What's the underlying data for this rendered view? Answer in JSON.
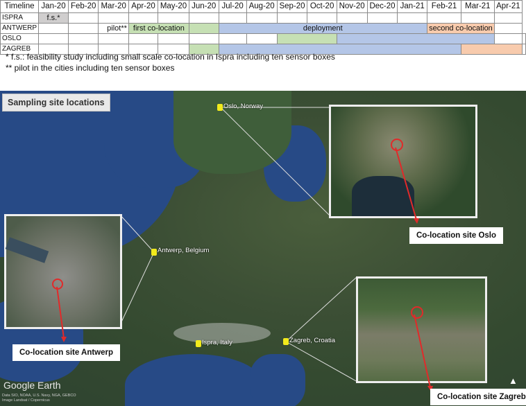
{
  "timeline": {
    "header_label": "Timeline",
    "months": [
      "Jan-20",
      "Feb-20",
      "Mar-20",
      "Apr-20",
      "May-20",
      "Jun-20",
      "Jul-20",
      "Aug-20",
      "Sep-20",
      "Oct-20",
      "Nov-20",
      "Dec-20",
      "Jan-21",
      "Feb-21",
      "Mar-21",
      "Apr-21"
    ],
    "rows": [
      {
        "label": "ISPRA",
        "bar_text": "f.s.*"
      },
      {
        "label": "ANTWERP",
        "pilot_text": "pilot**",
        "first_text": "first co-location",
        "deploy_text": "deployment",
        "second_text": "second co-location"
      },
      {
        "label": "OSLO"
      },
      {
        "label": "ZAGREB"
      }
    ],
    "colors": {
      "green": "#c6e0b4",
      "blue": "#b4c6e7",
      "orange": "#f8cbad",
      "gray": "#d0cece"
    }
  },
  "notes": {
    "line1": "* f.s.: feasibility study including small scale co-location in Ispra including ten sensor boxes",
    "line2": "** pilot in the cities including ten sensor boxes"
  },
  "map": {
    "title": "Sampling site locations",
    "places": {
      "oslo": "Oslo, Norway",
      "antwerp": "Antwerp, Belgium",
      "ispra": "Ispra, Italy",
      "zagreb": "Zagreb, Croatia"
    },
    "callouts": {
      "oslo": "Co-location site  Oslo",
      "antwerp": "Co-location site Antwerp",
      "zagreb": "Co-location site Zagreb"
    },
    "brand": "Google Earth",
    "credits": [
      "Data SIO, NOAA, U.S. Navy, NGA, GEBCO",
      "Image Landsat / Copernicus"
    ]
  }
}
